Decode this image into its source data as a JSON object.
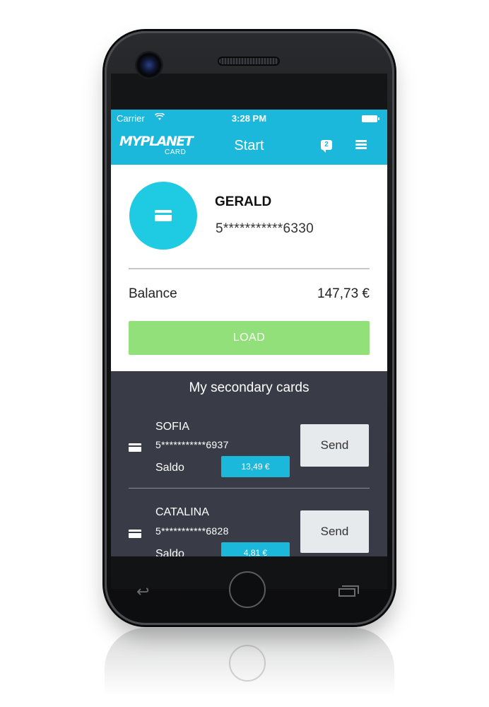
{
  "status_bar": {
    "carrier": "Carrier",
    "wifi_icon": "wifi-icon",
    "time": "3:28 PM",
    "battery_icon": "battery-icon"
  },
  "navbar": {
    "logo_main": "MYPLANET",
    "logo_sub": "CARD",
    "title": "Start",
    "messages_count": "2",
    "menu_icon": "hamburger-menu-icon"
  },
  "main_card": {
    "holder_name": "GERALD",
    "card_number": "5***********6330",
    "balance_label": "Balance",
    "balance_value": "147,73 €",
    "load_label": "LOAD"
  },
  "secondary": {
    "title": "My secondary cards",
    "cards": [
      {
        "name": "SOFIA",
        "number": "5***********6937",
        "saldo_label": "Saldo",
        "saldo_value": "13,49 €",
        "send_label": "Send"
      },
      {
        "name": "CATALINA",
        "number": "5***********6828",
        "saldo_label": "Saldo",
        "saldo_value": "4,81 €",
        "send_label": "Send"
      }
    ]
  },
  "colors": {
    "accent": "#1bb8db",
    "avatar": "#1fcbe2",
    "load_button": "#92e07a",
    "dark_panel": "#393c46"
  }
}
